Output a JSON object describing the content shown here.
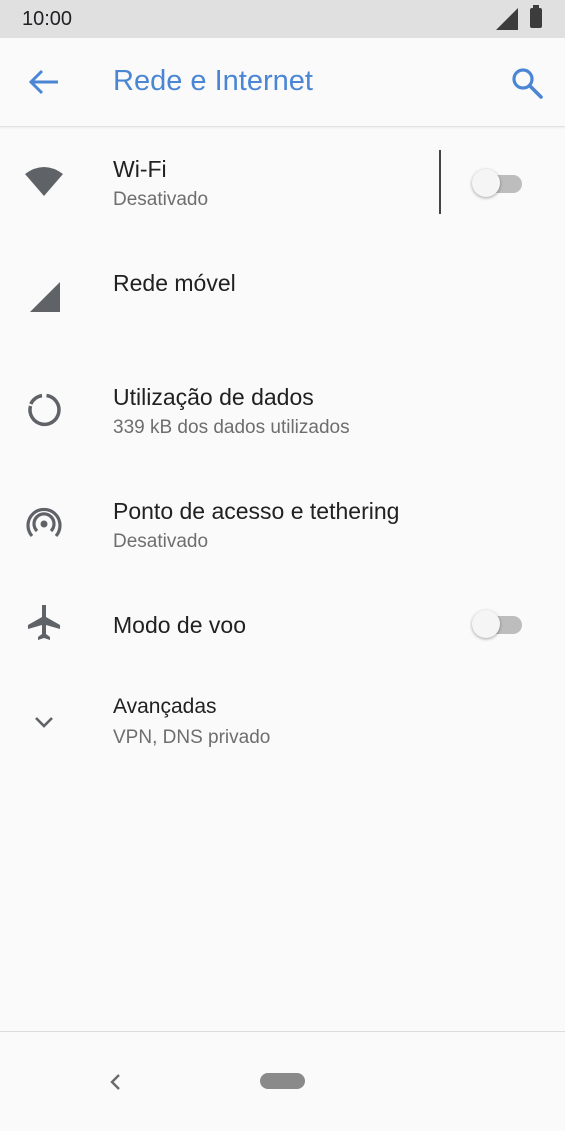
{
  "status_bar": {
    "time": "10:00"
  },
  "app_bar": {
    "title": "Rede e Internet"
  },
  "items": [
    {
      "title": "Wi-Fi",
      "subtitle": "Desativado",
      "icon": "wifi-icon",
      "toggle_on": false
    },
    {
      "title": "Rede móvel",
      "icon": "mobile-signal-icon"
    },
    {
      "title": "Utilização de dados",
      "subtitle": "339 kB dos dados utilizados",
      "icon": "data-usage-icon"
    },
    {
      "title": "Ponto de acesso e tethering",
      "subtitle": "Desativado",
      "icon": "hotspot-icon"
    },
    {
      "title": "Modo de voo",
      "icon": "airplane-icon",
      "toggle_on": false
    },
    {
      "title": "Avançadas",
      "subtitle": "VPN, DNS privado",
      "icon": "chevron-down-icon"
    }
  ],
  "colors": {
    "accent": "#4a86d4",
    "icon": "#5f6368",
    "text": "#212121",
    "subtext": "#6e6e6e"
  }
}
